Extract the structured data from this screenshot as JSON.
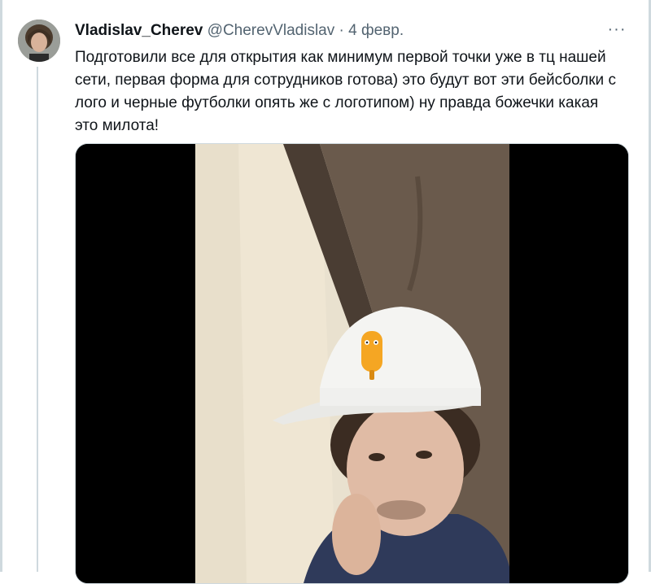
{
  "tweet": {
    "display_name": "Vladislav_Cherev",
    "handle": "@CherevVladislav",
    "separator": "·",
    "date": "4 февр.",
    "more_label": "···",
    "text": "Подготовили все для открытия как минимум первой точки уже в тц нашей сети, первая форма для сотрудников готова) это будут вот эти бейсболки с лого и черные футболки опять же с логотипом) ну правда божечки какая это милота!"
  },
  "icons": {
    "avatar": "user-avatar",
    "more": "more-horizontal-icon",
    "cap_logo": "popsicle-mascot-logo"
  },
  "media": {
    "type": "video-frame",
    "description_hidden": true
  },
  "colors": {
    "text_primary": "#0f1419",
    "text_secondary": "#536471",
    "border": "#cfd9de",
    "media_bg": "#000000",
    "logo_orange": "#f5a623"
  }
}
